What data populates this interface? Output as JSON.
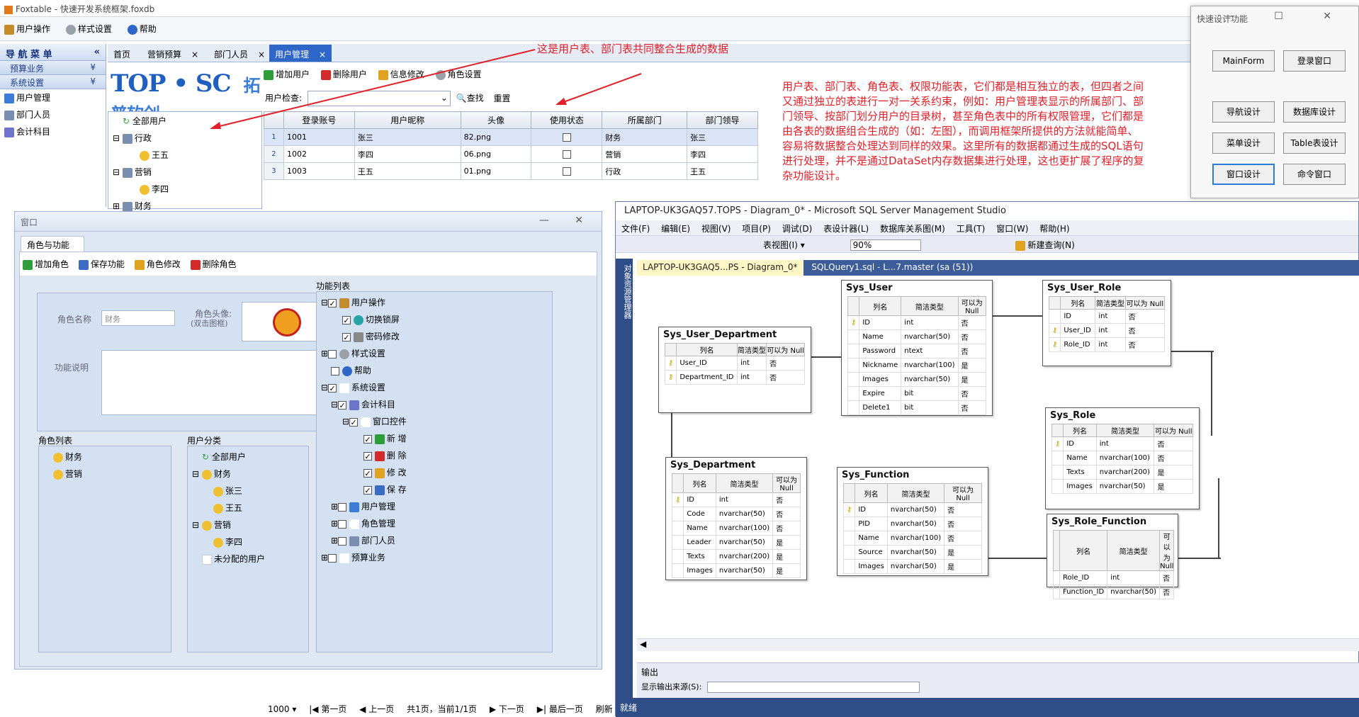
{
  "app": {
    "title": "Foxtable - 快速开发系统框架.foxdb",
    "menu": [
      "用户操作",
      "样式设置",
      "帮助"
    ]
  },
  "nav": {
    "header": "导 航 菜 单",
    "collapse": "«",
    "groups": [
      {
        "label": "预算业务",
        "arrow": "¥"
      },
      {
        "label": "系统设置",
        "arrow": "¥"
      }
    ],
    "items": [
      "用户管理",
      "部门人员",
      "会计科目"
    ]
  },
  "tabs": [
    {
      "label": "首页",
      "close": ""
    },
    {
      "label": "营销预算",
      "close": "×"
    },
    {
      "label": "部门人员",
      "close": "×"
    },
    {
      "label": "用户管理",
      "close": "×"
    }
  ],
  "logo": {
    "text": "TOP • SC",
    "text2": "拓普软创"
  },
  "user_toolbar": [
    "增加用户",
    "删除用户",
    "信息修改",
    "角色设置"
  ],
  "user_search": {
    "label": "用户检查:",
    "search": "查找",
    "reset": "重置"
  },
  "user_tree": [
    {
      "label": "全部用户",
      "sym": "",
      "depth": 0
    },
    {
      "label": "行政",
      "sym": "⊟",
      "depth": 0
    },
    {
      "label": "王五",
      "sym": "",
      "depth": 1
    },
    {
      "label": "营销",
      "sym": "⊟",
      "depth": 0
    },
    {
      "label": "李四",
      "sym": "",
      "depth": 1
    },
    {
      "label": "财务",
      "sym": "⊞",
      "depth": 0
    }
  ],
  "grid": {
    "headers": [
      "",
      "登录账号",
      "用户昵称",
      "头像",
      "使用状态",
      "所属部门",
      "部门领导"
    ],
    "rows": [
      {
        "no": "1",
        "account": "1001",
        "nickname": "张三",
        "avatar": "82.png",
        "enabled": false,
        "dept": "财务",
        "leader": "张三"
      },
      {
        "no": "2",
        "account": "1002",
        "nickname": "李四",
        "avatar": "06.png",
        "enabled": false,
        "dept": "营销",
        "leader": "李四"
      },
      {
        "no": "3",
        "account": "1003",
        "nickname": "王五",
        "avatar": "01.png",
        "enabled": false,
        "dept": "行政",
        "leader": "王五"
      }
    ]
  },
  "annotation_top": "这是用户表、部门表共同整合生成的数据",
  "annotation_right": "用户表、部门表、角色表、权限功能表，它们都是相互独立的表，但四者之间又通过独立的表进行一对一关系约束，例如：用户管理表显示的所属部门、部门领导、按部门划分用户的目录树，甚至角色表中的所有权限管理，它们都是由各表的数据组合生成的（如：左图），而调用框架所提供的方法就能简单、容易将数据整合处理达到同样的效果。这里所有的数据都通过生成的SQL语句进行处理，并不是通过DataSet内存数据集进行处理，这也更扩展了程序的复杂功能设计。",
  "quick": {
    "title": "快速设计功能",
    "controls": "— ☐ ✕",
    "buttons": [
      "MainForm",
      "登录窗口",
      "导航设计",
      "数据库设计",
      "菜单设计",
      "Table表设计",
      "窗口设计",
      "命令窗口"
    ]
  },
  "role_window": {
    "title": "窗口",
    "controls": "— ✕",
    "tab": "角色与功能",
    "toolbar": [
      "增加角色",
      "保存功能",
      "角色修改",
      "删除角色"
    ],
    "role_name_label": "角色名称",
    "role_name_value": "财务",
    "avatar_label": "角色头像:",
    "avatar_hint": "(双击图框)",
    "desc_label": "功能说明",
    "role_list_label": "角色列表",
    "role_list": [
      "财务",
      "营销"
    ],
    "user_group_label": "用户分类",
    "user_group": [
      {
        "label": "全部用户",
        "sym": "",
        "depth": 0
      },
      {
        "label": "财务",
        "sym": "⊟",
        "depth": 0
      },
      {
        "label": "张三",
        "sym": "",
        "depth": 1
      },
      {
        "label": "王五",
        "sym": "",
        "depth": 1
      },
      {
        "label": "营销",
        "sym": "⊟",
        "depth": 0
      },
      {
        "label": "李四",
        "sym": "",
        "depth": 1
      },
      {
        "label": "未分配的用户",
        "sym": "",
        "depth": 0
      }
    ],
    "func_label": "功能列表",
    "func_list": [
      {
        "label": "用户操作",
        "sym": "⊟",
        "depth": 0,
        "checked": true
      },
      {
        "label": "切换锁屏",
        "sym": "",
        "depth": 1,
        "checked": true
      },
      {
        "label": "密码修改",
        "sym": "",
        "depth": 1,
        "checked": true
      },
      {
        "label": "样式设置",
        "sym": "⊞",
        "depth": 0,
        "checked": false
      },
      {
        "label": "帮助",
        "sym": "",
        "depth": 0,
        "checked": false
      },
      {
        "label": "系统设置",
        "sym": "⊟",
        "depth": 0,
        "checked": true
      },
      {
        "label": "会计科目",
        "sym": "⊟",
        "depth": 1,
        "checked": true
      },
      {
        "label": "窗口控件",
        "sym": "⊟",
        "depth": 2,
        "checked": true
      },
      {
        "label": "新 增",
        "sym": "",
        "depth": 3,
        "checked": true
      },
      {
        "label": "删 除",
        "sym": "",
        "depth": 3,
        "checked": true
      },
      {
        "label": "修 改",
        "sym": "",
        "depth": 3,
        "checked": true
      },
      {
        "label": "保 存",
        "sym": "",
        "depth": 3,
        "checked": true
      },
      {
        "label": "用户管理",
        "sym": "⊞",
        "depth": 1,
        "checked": false
      },
      {
        "label": "角色管理",
        "sym": "⊞",
        "depth": 1,
        "checked": false
      },
      {
        "label": "部门人员",
        "sym": "⊞",
        "depth": 1,
        "checked": false
      },
      {
        "label": "预算业务",
        "sym": "⊞",
        "depth": 0,
        "checked": false
      }
    ]
  },
  "ssms": {
    "title": "LAPTOP-UK3GAQ57.TOPS - Diagram_0* - Microsoft SQL Server Management Studio",
    "menu": [
      "文件(F)",
      "编辑(E)",
      "视图(V)",
      "项目(P)",
      "调试(D)",
      "表设计器(L)",
      "数据库关系图(M)",
      "工具(T)",
      "窗口(W)",
      "帮助(H)"
    ],
    "toolbar_view": "表视图(I) ▾",
    "zoom": "90%",
    "new_query": "新建查询(N)",
    "side_panel": "对象资源管理器",
    "doc_tabs": [
      "LAPTOP-UK3GAQ5...PS - Diagram_0*",
      "SQLQuery1.sql - L...7.master (sa (51))"
    ],
    "col_headers": [
      "列名",
      "简洁类型",
      "可以为 Null"
    ],
    "tables": [
      {
        "name": "Sys_User_Department",
        "cols": [
          [
            "User_ID",
            "int",
            "否",
            true
          ],
          [
            "Department_ID",
            "int",
            "否",
            true
          ]
        ]
      },
      {
        "name": "Sys_User",
        "cols": [
          [
            "ID",
            "int",
            "否",
            true
          ],
          [
            "Name",
            "nvarchar(50)",
            "否",
            false
          ],
          [
            "Password",
            "ntext",
            "否",
            false
          ],
          [
            "Nickname",
            "nvarchar(100)",
            "是",
            false
          ],
          [
            "Images",
            "nvarchar(50)",
            "是",
            false
          ],
          [
            "Expire",
            "bit",
            "否",
            false
          ],
          [
            "Delete1",
            "bit",
            "否",
            false
          ]
        ]
      },
      {
        "name": "Sys_User_Role",
        "cols": [
          [
            "ID",
            "int",
            "否",
            false
          ],
          [
            "User_ID",
            "int",
            "否",
            true
          ],
          [
            "Role_ID",
            "int",
            "否",
            true
          ]
        ]
      },
      {
        "name": "Sys_Role",
        "cols": [
          [
            "ID",
            "int",
            "否",
            true
          ],
          [
            "Name",
            "nvarchar(100)",
            "否",
            false
          ],
          [
            "Texts",
            "nvarchar(200)",
            "是",
            false
          ],
          [
            "Images",
            "nvarchar(50)",
            "是",
            false
          ]
        ]
      },
      {
        "name": "Sys_Department",
        "cols": [
          [
            "ID",
            "int",
            "否",
            true
          ],
          [
            "Code",
            "nvarchar(50)",
            "否",
            false
          ],
          [
            "Name",
            "nvarchar(100)",
            "否",
            false
          ],
          [
            "Leader",
            "nvarchar(50)",
            "是",
            false
          ],
          [
            "Texts",
            "nvarchar(200)",
            "是",
            false
          ],
          [
            "Images",
            "nvarchar(50)",
            "是",
            false
          ]
        ]
      },
      {
        "name": "Sys_Function",
        "cols": [
          [
            "ID",
            "nvarchar(50)",
            "否",
            true
          ],
          [
            "PID",
            "nvarchar(50)",
            "否",
            false
          ],
          [
            "Name",
            "nvarchar(100)",
            "否",
            false
          ],
          [
            "Source",
            "nvarchar(50)",
            "是",
            false
          ],
          [
            "Images",
            "nvarchar(50)",
            "是",
            false
          ]
        ]
      },
      {
        "name": "Sys_Role_Function",
        "cols": [
          [
            "Role_ID",
            "int",
            "否",
            false
          ],
          [
            "Function_ID",
            "nvarchar(50)",
            "否",
            false
          ]
        ]
      }
    ],
    "output_label": "输出",
    "output_source": "显示输出来源(S):",
    "status": "就绪"
  },
  "pager": {
    "page_size": "1000",
    "first": "第一页",
    "prev": "上一页",
    "info": "共1页，当前1/1页",
    "next": "下一页",
    "last": "最后一页",
    "refresh": "刷新"
  },
  "colors": {
    "accent": "#2f67c9",
    "annotation": "#e0202a",
    "ssms_chrome": "#2f4e88"
  }
}
